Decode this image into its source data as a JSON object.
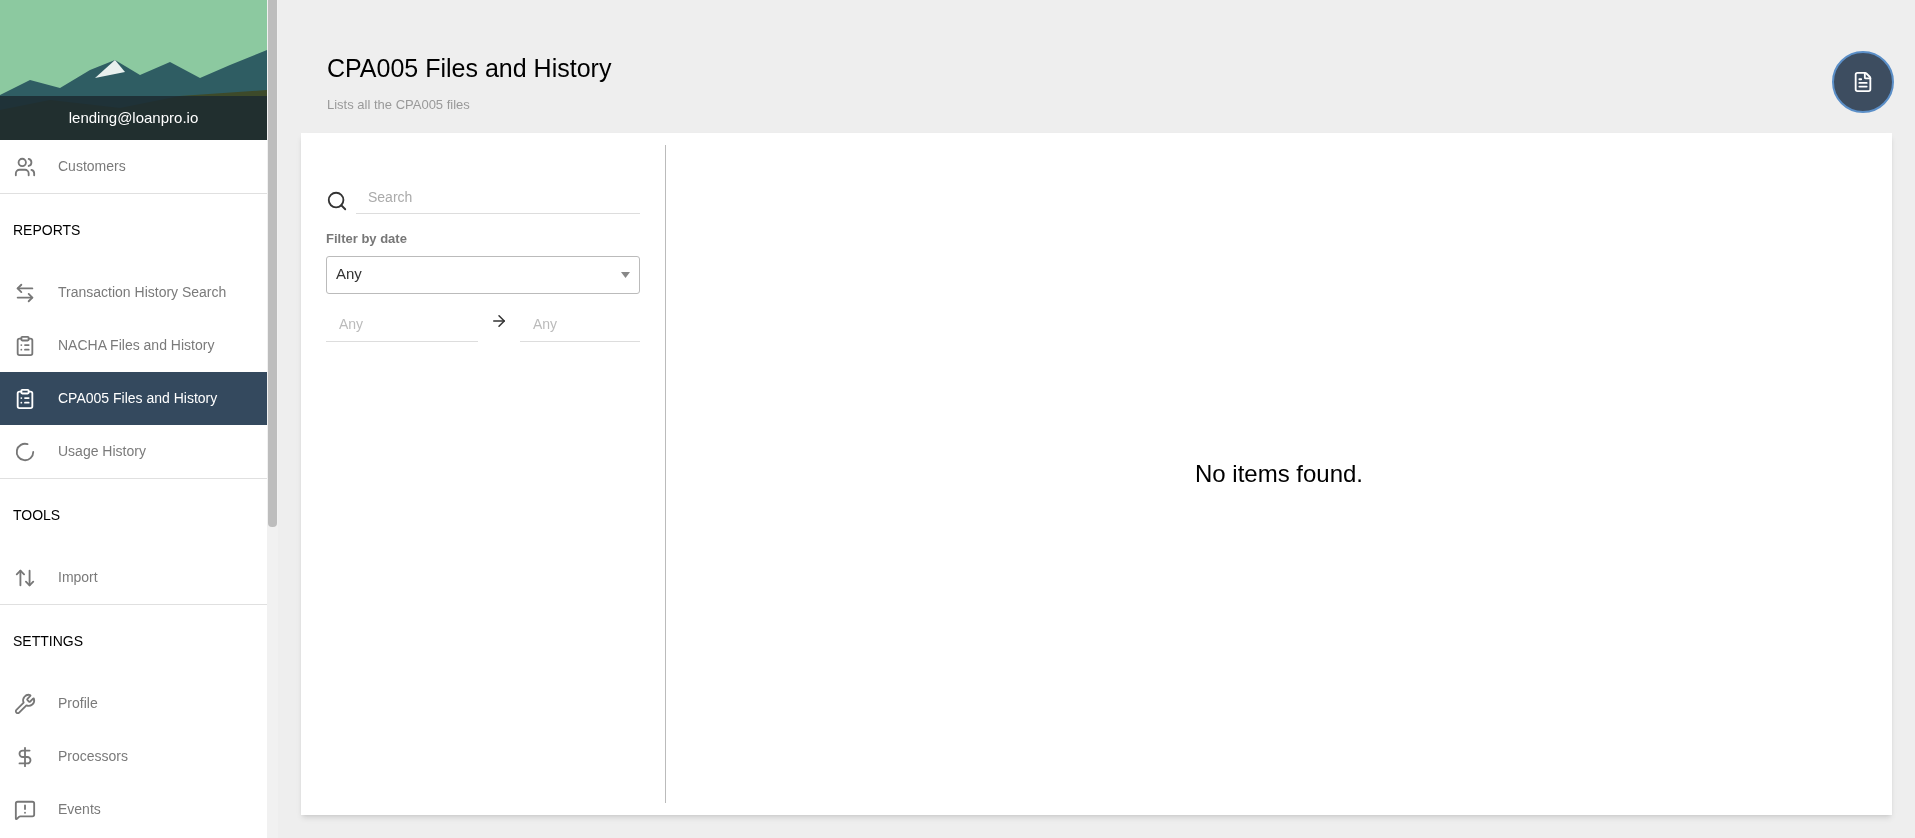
{
  "sidebar": {
    "user": "lending@loanpro.io",
    "groups": [
      {
        "items": [
          {
            "label": "Customers",
            "selected": false
          }
        ]
      },
      {
        "title": "REPORTS",
        "items": [
          {
            "label": "Transaction History Search",
            "selected": false
          },
          {
            "label": "NACHA Files and History",
            "selected": false
          },
          {
            "label": "CPA005 Files and History",
            "selected": true
          },
          {
            "label": "Usage History",
            "selected": false
          }
        ]
      },
      {
        "title": "TOOLS",
        "items": [
          {
            "label": "Import",
            "selected": false
          }
        ]
      },
      {
        "title": "SETTINGS",
        "items": [
          {
            "label": "Profile",
            "selected": false
          },
          {
            "label": "Processors",
            "selected": false
          },
          {
            "label": "Events",
            "selected": false
          }
        ]
      }
    ]
  },
  "page": {
    "title": "CPA005 Files and History",
    "subtitle": "Lists all the CPA005 files"
  },
  "filters": {
    "search": {
      "placeholder": "Search"
    },
    "date_label": "Filter by date",
    "date_select": {
      "value": "Any"
    },
    "from": {
      "placeholder": "Any"
    },
    "to": {
      "placeholder": "Any"
    }
  },
  "results": {
    "empty_message": "No items found."
  }
}
